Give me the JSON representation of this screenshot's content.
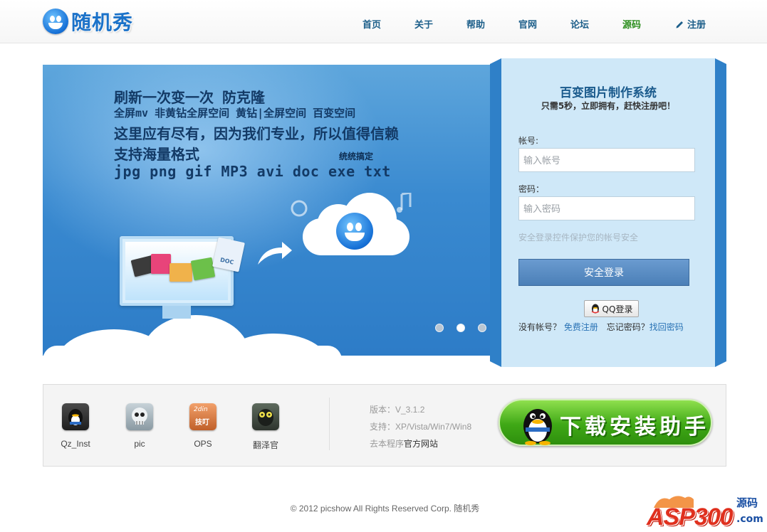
{
  "brand": {
    "name": "随机秀"
  },
  "nav": {
    "items": [
      {
        "label": "首页"
      },
      {
        "label": "关于"
      },
      {
        "label": "帮助"
      },
      {
        "label": "官网"
      },
      {
        "label": "论坛"
      },
      {
        "label": "源码"
      },
      {
        "label": "注册"
      }
    ]
  },
  "banner": {
    "line1": "刷新一次变一次 防克隆",
    "line2": "全屏mv 非黄钻全屏空间 黄钻|全屏空间 百变空间",
    "line3": "这里应有尽有，因为我们专业，所以值得信赖",
    "line4": "支持海量格式",
    "line5": "jpg png gif MP3 avi doc exe txt",
    "tag": "统统搞定",
    "file_label": "DOC",
    "slide_count": 3,
    "active_slide": 2
  },
  "login": {
    "title": "百变图片制作系统",
    "subtitle": "只需5秒，立即拥有，赶快注册吧！",
    "account_label": "帐号:",
    "account_placeholder": "输入帐号",
    "password_label": "密码：",
    "password_placeholder": "输入密码",
    "secure_tip": "安全登录控件保护您的帐号安全",
    "submit_label": "安全登录",
    "qq_label": "QQ登录",
    "no_account_text": "没有帐号？",
    "register_link": "免费注册",
    "forgot_text": "忘记密码？",
    "recover_link": "找回密码"
  },
  "apps": [
    {
      "label": "Qz_Inst",
      "icon": "penguin-icon"
    },
    {
      "label": "pic",
      "icon": "skull-icon"
    },
    {
      "label": "OPS",
      "icon": "ops-icon"
    },
    {
      "label": "翻泽官",
      "icon": "translator-icon"
    }
  ],
  "info": {
    "version": "版本：V_3.1.2",
    "support": "支持：XP/Vista/Win7/Win8",
    "site_prefix": "去本程序",
    "site_link": "官方网站",
    "ops_icon_text_top": "2din",
    "ops_icon_text_bottom": "技叮"
  },
  "download": {
    "label": "下载安装助手"
  },
  "footer": {
    "copyright": "© 2012 picshow All Rights Reserved Corp. 随机秀"
  },
  "watermark": {
    "main": "ASP300",
    "side": "源码",
    "domain": ".com"
  },
  "colors": {
    "nav_link": "#1d5f8a",
    "nav_active": "#2d8f1f",
    "banner": "#3a8ad0",
    "login_bg": "#cfe8f8",
    "download": "#3fa816"
  }
}
